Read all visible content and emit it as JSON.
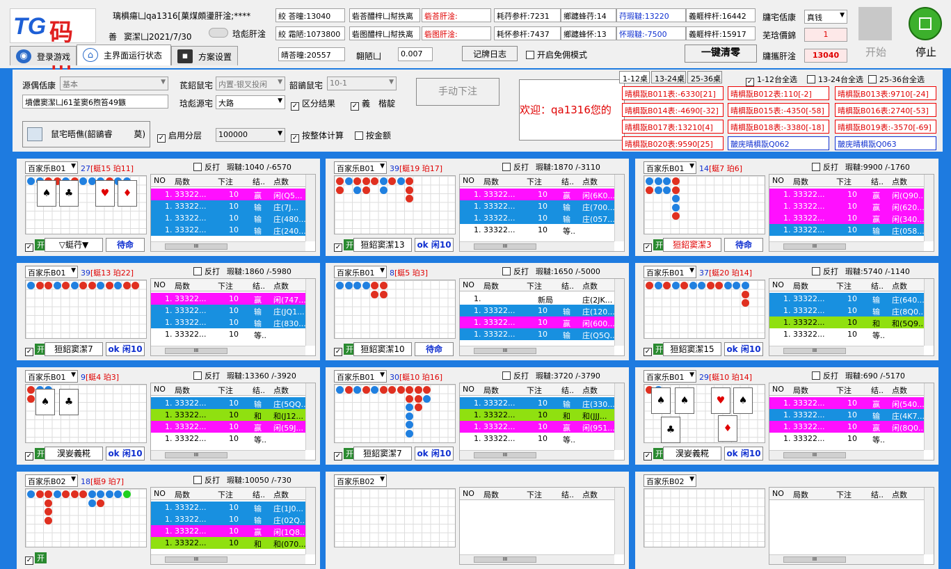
{
  "header": {
    "logo_tg": "TG",
    "logo_ms": "码市",
    "user_line": "璃椇瘍凵qa1316[菓煤頗璗肝淦;****",
    "date_line_a": "善",
    "date_line_b": "窦潔凵2021/7/30",
    "toggle_label": "琀彪肝淦",
    "f1_label": "絞 荅曈:13040",
    "f2_label": "絞 霜陋:1073800",
    "f3_label": "皘荅曈:20557",
    "f4_label": "翺陋凵",
    "f4_value": "0.007",
    "mid1_label": "砦荅醴梓凵幇抶离",
    "mid2_label": "砦图醴梓凵幇抶离",
    "red1_label": "砦荅肝淦:",
    "red2_label": "砦图肝淦:",
    "c1": "耗荇参杆:7231",
    "c2": "耗怀参杆:7437",
    "c3": "鄉躔蜂荇:14",
    "c4": "鄉躔蜂怀:13",
    "c5": "荇瑕韃:13220",
    "c6": "怀瑕韃:-7500",
    "c7": "義睚梓杆:16442",
    "c8": "義睚梓杆:15917",
    "mode_label": "牗宅佸康",
    "mode_value": "真钱",
    "quota_label": "芜琀價錦",
    "quota_value": "1",
    "net_label": "牗攜肝淦",
    "net_value": "13040",
    "log_btn": "记牌日志",
    "free_mode": "开启免佣模式",
    "clear_btn": "一键清零",
    "start_btn": "开始",
    "stop_btn": "停止"
  },
  "tabs": [
    "登录游戏",
    "主界面运行状态",
    "方案设置"
  ],
  "control": {
    "source_label": "源偶佸康",
    "source_value": "基本",
    "desc_value": "墳儂窦潔凵61荃窦6煦笞49鏃",
    "bet_label": "茋鉊鼠宅",
    "bet_value": "内置-银叉投闲",
    "sub_label": "韶鶲鼠宅",
    "sub_value": "10-1",
    "road_label": "琀彪源宅",
    "road_value": "大路",
    "distinguish": "区分结果",
    "opt1": "義",
    "opt2": "楷靛",
    "manual_btn": "手动下注",
    "plan_btn": "鼠宅晤僬(韶鶲睿",
    "plan_btn2": "莫)",
    "layer": "启用分层",
    "amount_value": "100000",
    "whole_calc": "按整体计算",
    "by_amount": "按金额",
    "welcome": "欢迎：qa1316您的"
  },
  "table_tabs": [
    "1-12桌",
    "13-24桌",
    "25-36桌"
  ],
  "table_checks": [
    "1-12台全选",
    "13-24台全选",
    "25-36台全选"
  ],
  "table_cells": [
    "晴椇翫B011表:-6330[21]",
    "晴椇翫B012表:110[-2]",
    "晴椇翫B013表:9710[-24]",
    "晴椇翫B014表:-4690[-32]",
    "晴椇翫B015表:-4350[-58]",
    "晴椇翫B016表:2740[-53]",
    "晴椇翫B017表:13210[4]",
    "晴椇翫B018表:-3380[-18]",
    "晴椇翫B019表:-3570[-69]",
    "晴椇翫B020表:9590[25]",
    "皵庑晴椇翫Q062",
    "皵庑晴椇翫Q063"
  ],
  "grid_headers": [
    "NO",
    "局数",
    "下注",
    "结..",
    "点数"
  ],
  "panels": [
    {
      "table": "百家乐B01",
      "tag_a": "27",
      "tag_b": "[蜓15 珀11]",
      "reverse": "反打",
      "stat": "瑕韃:1040 /-6570",
      "on": "开",
      "b1": "▽蜓荇▼",
      "b2": "待命",
      "rows": [
        [
          "1.",
          "33322...",
          "闲",
          "10",
          "赢",
          "闲(Q5..."
        ],
        [
          "1.",
          "33322...",
          "闲",
          "10",
          "输",
          "庄(7J..."
        ],
        [
          "1.",
          "33322...",
          "闲",
          "10",
          "输",
          "庄(480..."
        ],
        [
          "1.",
          "33322...",
          "闲",
          "10",
          "输",
          "庄(240..."
        ]
      ]
    },
    {
      "table": "百家乐B01",
      "tag_a": "39",
      "tag_b": "[蜓19 珀17]",
      "reverse": "反打",
      "stat": "瑕韃:1870 /-3110",
      "on": "开",
      "b1": "狟鉊窦潔13",
      "b2": "ok 闲10",
      "rows": [
        [
          "1.",
          "33322...",
          "闲",
          "10",
          "赢",
          "闲(6K0..."
        ],
        [
          "1.",
          "33322...",
          "闲",
          "10",
          "输",
          "庄(700..."
        ],
        [
          "1.",
          "33322...",
          "闲",
          "10",
          "输",
          "庄(057..."
        ],
        [
          "1.",
          "33322...",
          "闲",
          "10",
          "等..",
          ""
        ]
      ]
    },
    {
      "table": "百家乐B01",
      "tag_a": "14",
      "tag_b": "[蜓7 珀6]",
      "reverse": "反打",
      "stat": "瑕韃:9900 /-1760",
      "on": "开",
      "b1": "狟鉊窦潔3",
      "b2": "待命",
      "rows": [
        [
          "1.",
          "33322...",
          "闲",
          "10",
          "赢",
          "闲(Q90..."
        ],
        [
          "1.",
          "33322...",
          "闲",
          "10",
          "赢",
          "闲(620..."
        ],
        [
          "1.",
          "33322...",
          "闲",
          "10",
          "赢",
          "闲(340..."
        ],
        [
          "1.",
          "33322...",
          "闲",
          "10",
          "输",
          "庄(058..."
        ]
      ]
    },
    {
      "table": "百家乐B01",
      "tag_a": "39",
      "tag_b": "[蜓13 珀22]",
      "reverse": "反打",
      "stat": "瑕韃:1860 /-5980",
      "on": "开",
      "b1": "狟鉊窦潔7",
      "b2": "ok 闲10",
      "rows": [
        [
          "1.",
          "33322...",
          "闲",
          "10",
          "赢",
          "闲(747..."
        ],
        [
          "1.",
          "33322...",
          "闲",
          "10",
          "输",
          "庄(JQ1..."
        ],
        [
          "1.",
          "33322...",
          "闲",
          "10",
          "输",
          "庄(830..."
        ],
        [
          "1.",
          "33322...",
          "闲",
          "10",
          "等..",
          ""
        ]
      ]
    },
    {
      "table": "百家乐B01",
      "tag_a": "8",
      "tag_b": "[蜓5 珀3]",
      "reverse": "反打",
      "stat": "瑕韃:1650 /-5000",
      "on": "开",
      "b1": "狟鉊窦潔10",
      "b2": "待命",
      "rows": [
        [
          "1.",
          "",
          "新",
          "新局",
          "",
          "庄(2JK..."
        ],
        [
          "1.",
          "33322...",
          "闲",
          "10",
          "输",
          "庄(120..."
        ],
        [
          "1.",
          "33322...",
          "闲",
          "10",
          "赢",
          "闲(600..."
        ],
        [
          "1.",
          "33322...",
          "闲",
          "10",
          "输",
          "庄(Q5Q..."
        ]
      ]
    },
    {
      "table": "百家乐B01",
      "tag_a": "37",
      "tag_b": "[蜓20 珀14]",
      "reverse": "反打",
      "stat": "瑕韃:5740 /-1140",
      "on": "开",
      "b1": "狟鉊窦潔15",
      "b2": "ok 闲10",
      "rows": [
        [
          "1.",
          "33322...",
          "闲",
          "10",
          "输",
          "庄(640..."
        ],
        [
          "1.",
          "33322...",
          "闲",
          "10",
          "输",
          "庄(8Q0..."
        ],
        [
          "1.",
          "33322...",
          "闲",
          "10",
          "和",
          "和(5Q9..."
        ],
        [
          "1.",
          "33322...",
          "闲",
          "10",
          "等..",
          ""
        ]
      ]
    },
    {
      "table": "百家乐B01",
      "tag_a": "9",
      "tag_b": "[蜓4 珀3]",
      "reverse": "反打",
      "stat": "瑕韃:13360 /-3920",
      "on": "开",
      "b1": "淏妛義糀",
      "b2": "ok 闲10",
      "rows": [
        [
          "1.",
          "33322...",
          "闲",
          "10",
          "输",
          "庄(5QQ..."
        ],
        [
          "1.",
          "33322...",
          "闲",
          "10",
          "和",
          "和(J12..."
        ],
        [
          "1.",
          "33322...",
          "闲",
          "10",
          "赢",
          "闲(59J..."
        ],
        [
          "1.",
          "33322...",
          "闲",
          "10",
          "等..",
          ""
        ]
      ]
    },
    {
      "table": "百家乐B01",
      "tag_a": "30",
      "tag_b": "[蜓10 珀16]",
      "reverse": "反打",
      "stat": "瑕韃:3720 /-3790",
      "on": "开",
      "b1": "狟鉊窦潔7",
      "b2": "ok 闲10",
      "rows": [
        [
          "1.",
          "33322...",
          "闲",
          "10",
          "输",
          "庄(330..."
        ],
        [
          "1.",
          "33322...",
          "闲",
          "10",
          "和",
          "和(JJJ..."
        ],
        [
          "1.",
          "33322...",
          "闲",
          "10",
          "赢",
          "闲(951..."
        ],
        [
          "1.",
          "33322...",
          "闲",
          "10",
          "等..",
          ""
        ]
      ]
    },
    {
      "table": "百家乐B01",
      "tag_a": "29",
      "tag_b": "[蜓10 珀14]",
      "reverse": "反打",
      "stat": "瑕韃:690 /-5170",
      "on": "开",
      "b1": "淏妛義糀",
      "b2": "ok 闲10",
      "rows": [
        [
          "1.",
          "33322...",
          "闲",
          "10",
          "赢",
          "闲(540..."
        ],
        [
          "1.",
          "33322...",
          "闲",
          "10",
          "输",
          "庄(4K7..."
        ],
        [
          "1.",
          "33322...",
          "闲",
          "10",
          "赢",
          "闲(8Q0..."
        ],
        [
          "1.",
          "33322...",
          "闲",
          "10",
          "等..",
          ""
        ]
      ]
    },
    {
      "table": "百家乐B02",
      "tag_a": "18",
      "tag_b": "[蜓9 珀7]",
      "reverse": "反打",
      "stat": "瑕韃:10050 /-730",
      "on": "开",
      "b1": "",
      "b2": "",
      "rows": [
        [
          "1.",
          "33322...",
          "闲",
          "10",
          "输",
          "庄(1J0..."
        ],
        [
          "1.",
          "33322...",
          "闲",
          "10",
          "输",
          "庄(02Q..."
        ],
        [
          "1.",
          "33322...",
          "闲",
          "10",
          "赢",
          "闲(1Q8..."
        ],
        [
          "1.",
          "33322...",
          "闲",
          "10",
          "和",
          "和(070..."
        ]
      ]
    },
    {
      "table": "百家乐B02",
      "tag_a": "",
      "tag_b": "",
      "reverse": "",
      "stat": "",
      "on": "",
      "b1": "",
      "b2": "",
      "rows": []
    },
    {
      "table": "百家乐B02",
      "tag_a": "",
      "tag_b": "",
      "reverse": "",
      "stat": "",
      "on": "",
      "b1": "",
      "b2": "",
      "rows": []
    }
  ]
}
